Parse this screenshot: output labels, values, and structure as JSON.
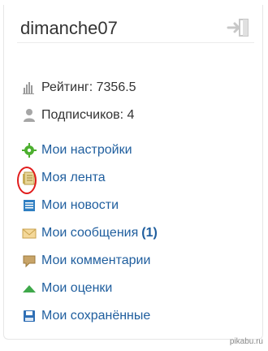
{
  "user": {
    "name": "dimanche07"
  },
  "stats": {
    "rating": "Рейтинг: 7356.5",
    "followers": "Подписчиков: 4"
  },
  "menu": {
    "items": [
      {
        "label": "Мои настройки"
      },
      {
        "label": "Моя лента"
      },
      {
        "label": "Мои новости"
      },
      {
        "label": "Мои сообщения",
        "count": "(1)"
      },
      {
        "label": "Мои комментарии"
      },
      {
        "label": "Мои оценки"
      },
      {
        "label": "Мои сохранённые"
      }
    ]
  },
  "watermark": "pikabu.ru",
  "colors": {
    "link": "#1f5e9e",
    "text": "#333333",
    "annotation": "#e11c1c"
  }
}
